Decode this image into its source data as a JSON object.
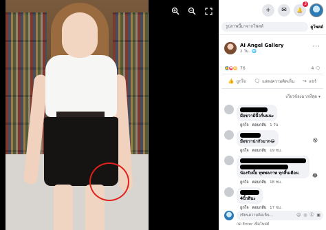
{
  "photo_tools": {
    "zoom_in_icon": "zoom-in-icon",
    "zoom_out_icon": "zoom-out-icon",
    "fullscreen_icon": "expand-icon"
  },
  "topbar": {
    "plus_glyph": "+",
    "messenger_glyph": "✉",
    "bell_glyph": "🔔",
    "notification_count": "3"
  },
  "search": {
    "placeholder": "รูปภาพนี้มาจากโพสต์",
    "view_profile": "ดูโพสต์"
  },
  "post": {
    "page_name": "AI Angel Gallery",
    "time": "2 วัน · 🌐",
    "more": "···",
    "reaction_count": "76",
    "comment_count": "4"
  },
  "actions": {
    "like": "ถูกใจ",
    "comment": "แสดงความคิดเห็น",
    "share": "แชร์"
  },
  "sort_label": "เกี่ยวข้องมากที่สุด ▾",
  "comments": [
    {
      "text": "มือขวามีนิ้วกี่นนนะ",
      "like": "ถูกใจ",
      "reply": "ตอบกลับ",
      "time": "1 วัน",
      "emoji": ""
    },
    {
      "text": "มือขวาน่ากัวมาก😂",
      "like": "ถูกใจ",
      "reply": "ตอบกลับ",
      "time": "19 ชม.",
      "emoji": "😮"
    },
    {
      "text": "น้องรับมั้ย ทุพพลภาพ ทุกสิ้นเดือน",
      "like": "ถูกใจ",
      "reply": "ตอบกลับ",
      "time": "18 ชม.",
      "emoji": "😂"
    },
    {
      "text": "4นิ้วสินะ",
      "like": "ถูกใจ",
      "reply": "ตอบกลับ",
      "time": "17 ชม.",
      "emoji": ""
    }
  ],
  "write": {
    "placeholder": "เขียนความคิดเห็น...",
    "icons": "☺ ◎ ⓖ ▣",
    "hint": "กด Enter เพื่อโพสต์"
  },
  "colors": {
    "accent": "#1877f2",
    "circle": "#e0201a"
  }
}
